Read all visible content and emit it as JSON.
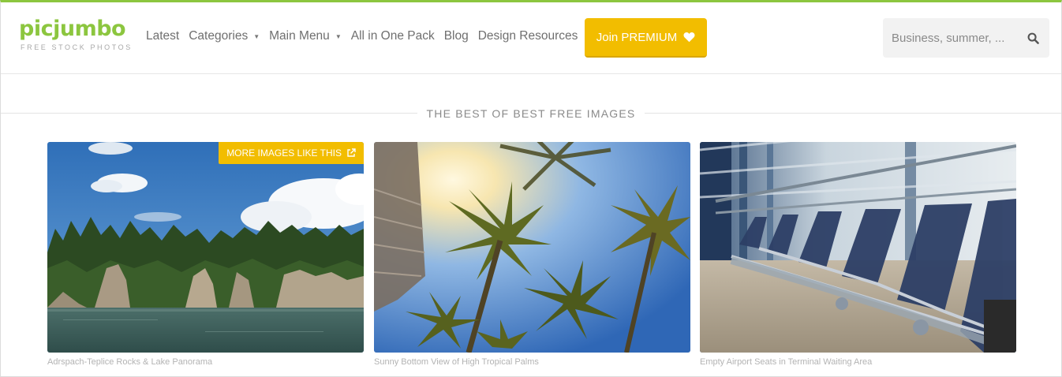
{
  "brand": {
    "name": "picjumbo",
    "tagline": "FREE STOCK PHOTOS",
    "accent": "#8cc63f",
    "premium_color": "#f2bd00"
  },
  "nav": {
    "items": [
      {
        "label": "Latest"
      },
      {
        "label": "Categories",
        "dropdown": true
      },
      {
        "label": "Main Menu",
        "dropdown": true
      },
      {
        "label": "All in One Pack"
      },
      {
        "label": "Blog"
      },
      {
        "label": "Design Resources"
      }
    ],
    "premium_label": "Join PREMIUM",
    "premium_icon": "heart-icon"
  },
  "search": {
    "placeholder": "Business, summer, ...",
    "icon": "search-icon"
  },
  "section": {
    "title": "THE BEST OF BEST FREE IMAGES"
  },
  "gallery": {
    "more_label": "MORE IMAGES LIKE THIS",
    "items": [
      {
        "caption": "Adrspach-Teplice Rocks & Lake Panorama"
      },
      {
        "caption": "Sunny Bottom View of High Tropical Palms"
      },
      {
        "caption": "Empty Airport Seats in Terminal Waiting Area"
      }
    ]
  }
}
